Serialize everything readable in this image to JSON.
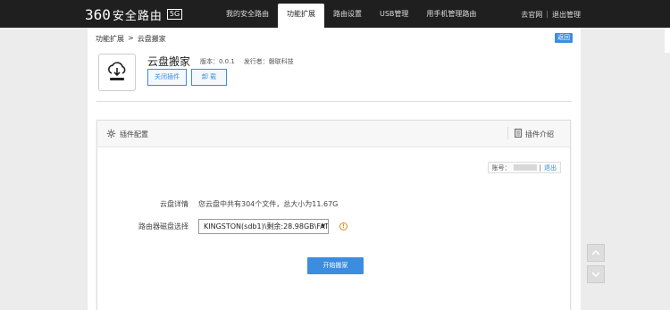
{
  "header": {
    "logo_number": "360",
    "logo_text": "安全路由",
    "logo_badge": "5G",
    "nav": [
      {
        "label": "我的安全路由"
      },
      {
        "label": "功能扩展"
      },
      {
        "label": "路由设置"
      },
      {
        "label": "USB管理"
      },
      {
        "label": "用手机管理路由"
      }
    ],
    "links": {
      "official": "去官网",
      "separator": "|",
      "logout": "退出管理"
    }
  },
  "breadcrumb": {
    "parent": "功能扩展",
    "separator": ">",
    "current": "云盘搬家"
  },
  "back_label": "返回",
  "app": {
    "name": "云盘搬家",
    "version": "版本：0.0.1",
    "publisher": "发行者：磐联科技",
    "icon": "cloud-upload-icon",
    "buttons": {
      "close_plugin": "关闭插件",
      "uninstall": "卸 载"
    }
  },
  "panel": {
    "config_label": "插件配置",
    "intro_label": "插件介绍",
    "account_label": "账号：",
    "account_logout": "退出",
    "detail_label": "云盘详情",
    "detail_value": "您云盘中共有304个文件，总大小为11.67G",
    "disk_label": "路由器磁盘选择",
    "disk_selected": "KINGSTON(sdb1)\\剩余:28.98GB\\FAT",
    "start_label": "开始搬家"
  },
  "colors": {
    "accent": "#3b8de0",
    "topbar": "#1f1f1f",
    "warning": "#e08a1e"
  }
}
